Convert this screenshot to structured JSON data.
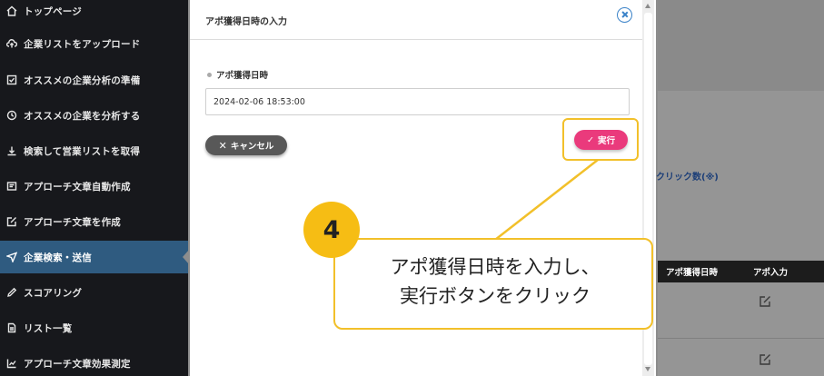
{
  "sidebar": {
    "items": [
      {
        "label": "トップページ",
        "icon": "home-icon"
      },
      {
        "label": "企業リストをアップロード",
        "icon": "cloud-upload-icon"
      },
      {
        "label": "オススメの企業分析の準備",
        "icon": "checkbox-icon"
      },
      {
        "label": "オススメの企業を分析する",
        "icon": "history-icon"
      },
      {
        "label": "検索して営業リストを取得",
        "icon": "download-icon"
      },
      {
        "label": "アプローチ文章自動作成",
        "icon": "document-icon"
      },
      {
        "label": "アプローチ文章を作成",
        "icon": "edit-box-icon"
      },
      {
        "label": "企業検索・送信",
        "icon": "send-icon",
        "active": true
      },
      {
        "label": "スコアリング",
        "icon": "pencil-icon"
      },
      {
        "label": "リスト一覧",
        "icon": "list-file-icon"
      },
      {
        "label": "アプローチ文章効果測定",
        "icon": "chart-icon"
      }
    ]
  },
  "background": {
    "click_count_label": "クリック数(※)",
    "table_headers": [
      "アポ獲得日時",
      "アポ入力"
    ]
  },
  "modal": {
    "title": "アポ獲得日時の入力",
    "field_label": "アポ獲得日時",
    "field_value": "2024-02-06 18:53:00",
    "cancel_label": "キャンセル",
    "execute_label": "実行"
  },
  "callout": {
    "step_number": "4",
    "line1": "アポ獲得日時を入力し、",
    "line2": "実行ボタンをクリック"
  },
  "colors": {
    "sidebar_bg": "#17181c",
    "active_item": "#2f5b80",
    "execute_button": "#ea3a7c",
    "highlight": "#f2c02a",
    "close_icon": "#3a82c8"
  }
}
